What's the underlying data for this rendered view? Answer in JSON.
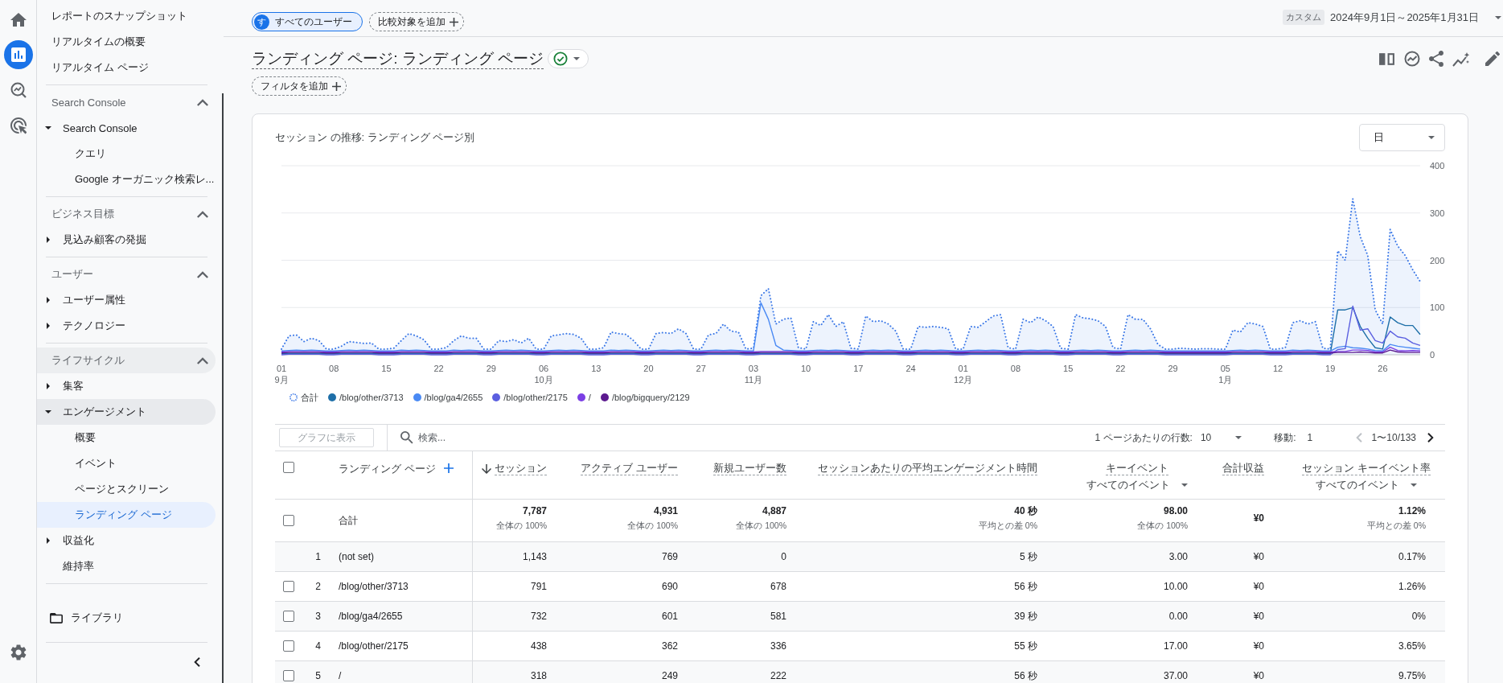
{
  "rail": [
    {
      "selected": false
    },
    {
      "selected": true
    },
    {
      "selected": false
    },
    {
      "selected": false
    }
  ],
  "nav": {
    "top_items": [
      {
        "label": "レポートのスナップショット",
        "selected": false
      },
      {
        "label": "リアルタイムの概要",
        "selected": false
      },
      {
        "label": "リアルタイム ページ",
        "selected": false
      }
    ],
    "sections": [
      {
        "title": "Search Console",
        "expanded": true,
        "highlighted": false,
        "items": [
          {
            "label": "Search Console",
            "expanded": true,
            "highlighted": false,
            "children": [
              {
                "label": "クエリ",
                "selected": false
              },
              {
                "label": "Google オーガニック検索レ...",
                "selected": false
              }
            ]
          }
        ]
      },
      {
        "title": "ビジネス目標",
        "expanded": true,
        "highlighted": false,
        "items": [
          {
            "label": "見込み顧客の発掘",
            "expanded": false,
            "highlighted": false
          }
        ]
      },
      {
        "title": "ユーザー",
        "expanded": true,
        "highlighted": false,
        "items": [
          {
            "label": "ユーザー属性",
            "expanded": false,
            "highlighted": false
          },
          {
            "label": "テクノロジー",
            "expanded": false,
            "highlighted": false
          }
        ]
      },
      {
        "title": "ライフサイクル",
        "expanded": true,
        "highlighted": true,
        "items": [
          {
            "label": "集客",
            "expanded": false,
            "highlighted": false
          },
          {
            "label": "エンゲージメント",
            "expanded": true,
            "highlighted": true,
            "children": [
              {
                "label": "概要",
                "selected": false
              },
              {
                "label": "イベント",
                "selected": false
              },
              {
                "label": "ページとスクリーン",
                "selected": false
              },
              {
                "label": "ランディング ページ",
                "selected": true
              }
            ]
          },
          {
            "label": "収益化",
            "expanded": false,
            "highlighted": false
          },
          {
            "label": "維持率",
            "highlighted": false
          }
        ]
      }
    ],
    "library": "ライブラリ"
  },
  "top_bar": {
    "segments": [
      {
        "avatar": "す",
        "label": "すべてのユーザー"
      }
    ],
    "add_comparison": "比較対象を追加",
    "date_badge": "カスタム",
    "date_range": "2024年9月1日～2025年1月31日"
  },
  "report": {
    "title": "ランディング ページ: ランディング ページ",
    "add_filter": "フィルタを追加"
  },
  "chart_card": {
    "granularity": "日",
    "chart_data": {
      "type": "line",
      "title": "セッション の推移: ランディング ページ別",
      "grid": true,
      "categories": [
        "01\n9月",
        null,
        null,
        null,
        null,
        null,
        null,
        "08",
        null,
        null,
        null,
        null,
        null,
        null,
        "15",
        null,
        null,
        null,
        null,
        null,
        null,
        "22",
        null,
        null,
        null,
        null,
        null,
        null,
        "29",
        null,
        null,
        null,
        null,
        null,
        null,
        "06\n10月",
        null,
        null,
        null,
        null,
        null,
        null,
        "13",
        null,
        null,
        null,
        null,
        null,
        null,
        "20",
        null,
        null,
        null,
        null,
        null,
        null,
        "27",
        null,
        null,
        null,
        null,
        null,
        null,
        "03\n11月",
        null,
        null,
        null,
        null,
        null,
        null,
        "10",
        null,
        null,
        null,
        null,
        null,
        null,
        "17",
        null,
        null,
        null,
        null,
        null,
        null,
        "24",
        null,
        null,
        null,
        null,
        null,
        null,
        "01\n12月",
        null,
        null,
        null,
        null,
        null,
        null,
        "08",
        null,
        null,
        null,
        null,
        null,
        null,
        "15",
        null,
        null,
        null,
        null,
        null,
        null,
        "22",
        null,
        null,
        null,
        null,
        null,
        null,
        "29",
        null,
        null,
        null,
        null,
        null,
        null,
        "05\n1月",
        null,
        null,
        null,
        null,
        null,
        null,
        "12",
        null,
        null,
        null,
        null,
        null,
        null,
        "19",
        null,
        null,
        null,
        null,
        null,
        null,
        "26",
        null,
        null,
        null,
        null,
        null
      ],
      "ylim": [
        0,
        400
      ],
      "yticks": [
        0,
        100,
        200,
        300,
        400
      ],
      "series": [
        {
          "name": "合計",
          "type": "area",
          "line_style": "dotted",
          "color": "#3b78e7",
          "values": [
            12,
            40,
            42,
            28,
            35,
            30,
            12,
            12,
            18,
            28,
            26,
            24,
            25,
            12,
            12,
            14,
            30,
            45,
            40,
            32,
            12,
            12,
            15,
            30,
            40,
            35,
            35,
            12,
            12,
            30,
            28,
            32,
            25,
            35,
            12,
            12,
            40,
            42,
            45,
            43,
            35,
            12,
            12,
            15,
            48,
            45,
            43,
            30,
            12,
            12,
            45,
            47,
            45,
            55,
            45,
            12,
            12,
            42,
            45,
            65,
            50,
            48,
            12,
            14,
            125,
            140,
            65,
            75,
            78,
            15,
            12,
            70,
            62,
            85,
            60,
            70,
            14,
            12,
            82,
            70,
            72,
            65,
            50,
            12,
            12,
            60,
            58,
            60,
            58,
            55,
            12,
            12,
            60,
            58,
            70,
            82,
            85,
            15,
            12,
            75,
            68,
            80,
            72,
            60,
            14,
            12,
            85,
            78,
            76,
            72,
            60,
            15,
            12,
            85,
            75,
            75,
            55,
            22,
            12,
            12,
            14,
            13,
            12,
            13,
            13,
            12,
            12,
            52,
            48,
            68,
            65,
            60,
            12,
            12,
            15,
            68,
            72,
            65,
            70,
            14,
            12,
            220,
            200,
            330,
            250,
            210,
            95,
            65,
            265,
            230,
            210,
            180,
            155
          ]
        },
        {
          "name": "/blog/other/3713",
          "line_style": "solid",
          "color": "#1e6fa8",
          "values": [
            2,
            3,
            3,
            3,
            3,
            3,
            2,
            2,
            3,
            3,
            3,
            3,
            3,
            2,
            2,
            2,
            3,
            3,
            3,
            3,
            2,
            2,
            2,
            3,
            3,
            3,
            3,
            2,
            2,
            3,
            3,
            3,
            3,
            3,
            2,
            2,
            3,
            3,
            3,
            3,
            3,
            2,
            2,
            2,
            3,
            3,
            3,
            3,
            2,
            2,
            3,
            3,
            3,
            3,
            3,
            2,
            2,
            3,
            3,
            3,
            3,
            3,
            2,
            2,
            3,
            3,
            3,
            3,
            3,
            2,
            2,
            3,
            3,
            3,
            3,
            3,
            2,
            2,
            3,
            3,
            3,
            3,
            3,
            2,
            2,
            3,
            3,
            3,
            3,
            3,
            2,
            2,
            3,
            3,
            3,
            3,
            3,
            2,
            2,
            3,
            3,
            3,
            3,
            3,
            2,
            2,
            3,
            3,
            3,
            3,
            3,
            2,
            2,
            3,
            3,
            3,
            3,
            3,
            2,
            2,
            2,
            2,
            2,
            2,
            2,
            2,
            2,
            3,
            3,
            3,
            3,
            3,
            2,
            2,
            2,
            3,
            3,
            3,
            3,
            2,
            2,
            95,
            95,
            100,
            60,
            35,
            15,
            12,
            80,
            68,
            62,
            62,
            43
          ]
        },
        {
          "name": "/blog/ga4/2655",
          "line_style": "solid",
          "color": "#4a8af4",
          "values": [
            8,
            9,
            10,
            9,
            10,
            9,
            8,
            8,
            9,
            10,
            9,
            10,
            9,
            8,
            8,
            8,
            10,
            9,
            10,
            9,
            8,
            8,
            8,
            10,
            9,
            10,
            9,
            8,
            8,
            9,
            10,
            9,
            10,
            9,
            8,
            8,
            9,
            10,
            9,
            10,
            9,
            8,
            8,
            8,
            10,
            9,
            10,
            9,
            8,
            8,
            9,
            10,
            9,
            10,
            9,
            8,
            8,
            9,
            10,
            9,
            10,
            9,
            8,
            8,
            110,
            75,
            20,
            10,
            9,
            8,
            8,
            9,
            10,
            9,
            10,
            9,
            8,
            8,
            9,
            10,
            9,
            10,
            9,
            8,
            8,
            9,
            10,
            9,
            10,
            9,
            8,
            8,
            9,
            10,
            9,
            10,
            9,
            8,
            8,
            9,
            10,
            9,
            10,
            9,
            8,
            8,
            9,
            10,
            9,
            10,
            9,
            8,
            8,
            9,
            10,
            9,
            10,
            9,
            8,
            8,
            8,
            8,
            8,
            8,
            8,
            8,
            8,
            9,
            10,
            9,
            10,
            9,
            8,
            8,
            8,
            10,
            9,
            10,
            9,
            8,
            8,
            16,
            18,
            15,
            14,
            12,
            9,
            8,
            22,
            18,
            16,
            14,
            12
          ]
        },
        {
          "name": "/blog/other/2175",
          "line_style": "solid",
          "color": "#5b5fe0",
          "values": [
            0,
            1,
            1,
            1,
            1,
            1,
            0,
            0,
            1,
            1,
            1,
            1,
            1,
            0,
            0,
            0,
            1,
            1,
            1,
            1,
            0,
            0,
            0,
            1,
            1,
            1,
            1,
            0,
            0,
            1,
            1,
            1,
            1,
            1,
            0,
            0,
            1,
            1,
            1,
            1,
            1,
            0,
            0,
            0,
            1,
            1,
            1,
            1,
            0,
            0,
            1,
            1,
            1,
            1,
            1,
            0,
            0,
            1,
            1,
            1,
            1,
            1,
            0,
            0,
            1,
            1,
            1,
            1,
            1,
            0,
            0,
            1,
            1,
            1,
            1,
            1,
            0,
            0,
            1,
            1,
            1,
            1,
            1,
            0,
            0,
            1,
            1,
            1,
            1,
            1,
            0,
            0,
            1,
            1,
            1,
            1,
            1,
            0,
            0,
            1,
            1,
            1,
            1,
            1,
            0,
            0,
            1,
            1,
            1,
            1,
            1,
            0,
            0,
            1,
            1,
            1,
            1,
            1,
            0,
            0,
            0,
            0,
            0,
            0,
            0,
            0,
            0,
            1,
            1,
            1,
            1,
            1,
            0,
            0,
            0,
            1,
            1,
            1,
            1,
            0,
            0,
            11,
            13,
            103,
            52,
            55,
            30,
            25,
            50,
            38,
            35,
            25,
            20
          ]
        },
        {
          "name": "/",
          "line_style": "solid",
          "color": "#7b3fe4",
          "values": [
            6,
            7,
            7,
            7,
            7,
            7,
            6,
            6,
            7,
            7,
            7,
            7,
            7,
            6,
            6,
            6,
            7,
            7,
            7,
            7,
            6,
            6,
            6,
            7,
            7,
            7,
            7,
            6,
            6,
            7,
            7,
            7,
            7,
            7,
            6,
            6,
            7,
            7,
            7,
            7,
            7,
            6,
            6,
            6,
            7,
            7,
            7,
            7,
            6,
            6,
            7,
            7,
            7,
            7,
            7,
            6,
            6,
            7,
            7,
            7,
            7,
            7,
            6,
            6,
            7,
            7,
            7,
            7,
            7,
            6,
            6,
            7,
            7,
            7,
            7,
            7,
            6,
            6,
            7,
            7,
            7,
            7,
            7,
            6,
            6,
            7,
            7,
            7,
            7,
            7,
            6,
            6,
            7,
            7,
            7,
            7,
            7,
            6,
            6,
            7,
            7,
            7,
            7,
            7,
            6,
            6,
            7,
            7,
            7,
            7,
            7,
            6,
            6,
            7,
            7,
            7,
            7,
            7,
            6,
            6,
            6,
            6,
            6,
            6,
            6,
            6,
            6,
            7,
            7,
            7,
            7,
            7,
            6,
            6,
            6,
            7,
            7,
            7,
            7,
            6,
            6,
            7,
            7,
            10,
            10,
            9,
            6,
            6,
            16,
            9,
            8,
            9,
            8
          ]
        },
        {
          "name": "/blog/bigquery/2129",
          "line_style": "solid",
          "color": "#5c1a8f",
          "values": [
            4,
            5,
            5,
            5,
            5,
            5,
            4,
            4,
            5,
            5,
            5,
            5,
            5,
            4,
            4,
            4,
            5,
            5,
            5,
            5,
            4,
            4,
            4,
            5,
            5,
            5,
            5,
            4,
            4,
            5,
            5,
            5,
            5,
            5,
            4,
            4,
            5,
            5,
            5,
            5,
            5,
            4,
            4,
            4,
            5,
            5,
            5,
            5,
            4,
            4,
            5,
            5,
            5,
            5,
            5,
            4,
            4,
            5,
            5,
            5,
            5,
            5,
            4,
            4,
            5,
            5,
            5,
            5,
            5,
            4,
            4,
            5,
            5,
            5,
            5,
            5,
            4,
            4,
            5,
            5,
            5,
            5,
            5,
            4,
            4,
            5,
            5,
            5,
            5,
            5,
            4,
            4,
            5,
            5,
            5,
            5,
            5,
            4,
            4,
            5,
            5,
            5,
            5,
            5,
            4,
            4,
            5,
            5,
            5,
            5,
            5,
            4,
            4,
            5,
            5,
            5,
            5,
            5,
            4,
            4,
            4,
            4,
            4,
            4,
            4,
            4,
            4,
            5,
            5,
            5,
            5,
            5,
            4,
            4,
            4,
            5,
            5,
            5,
            5,
            4,
            4,
            5,
            5,
            5,
            6,
            5,
            4,
            4,
            10,
            6,
            5,
            5,
            5
          ]
        }
      ]
    }
  },
  "table": {
    "chart_button": {
      "label": "グラフに表示",
      "disabled": true
    },
    "search_placeholder": "検索...",
    "rows_per_page_label": "1 ページあたりの行数:",
    "rows_per_page": "10",
    "go_to_label": "移動:",
    "go_to_value": "1",
    "page_range": "1〜10/133",
    "previous_disabled": true,
    "next_disabled": false,
    "select_all_checked": false,
    "dimension_header": "ランディング ページ",
    "columns": [
      {
        "label": "セッション",
        "sorted": true
      },
      {
        "label": "アクティブ ユーザー",
        "sorted": false
      },
      {
        "label": "新規ユーザー数",
        "sorted": false
      },
      {
        "label": "セッションあたりの平均エンゲージメント時間",
        "sorted": false
      },
      {
        "label": "キーイベント",
        "sorted": false,
        "filter": "すべてのイベント"
      },
      {
        "label": "合計収益",
        "sorted": false
      },
      {
        "label": "セッション キーイベント率",
        "sorted": false,
        "filter": "すべてのイベント"
      }
    ],
    "totals": {
      "label": "合計",
      "checked": false,
      "cells": [
        {
          "value": "7,787",
          "note": "全体の 100%"
        },
        {
          "value": "4,931",
          "note": "全体の 100%"
        },
        {
          "value": "4,887",
          "note": "全体の 100%"
        },
        {
          "value": "40 秒",
          "note": "平均との差 0%"
        },
        {
          "value": "98.00",
          "note": "全体の 100%"
        },
        {
          "value": "¥0"
        },
        {
          "value": "1.12%",
          "note": "平均との差 0%"
        }
      ]
    },
    "rows": [
      {
        "rank": "1",
        "name": "(not set)",
        "cells": [
          "1,143",
          "769",
          "0",
          "5 秒",
          "3.00",
          "¥0",
          "0.17%"
        ]
      },
      {
        "rank": "2",
        "name": "/blog/other/3713",
        "checked": false,
        "cells": [
          "791",
          "690",
          "678",
          "56 秒",
          "10.00",
          "¥0",
          "1.26%"
        ]
      },
      {
        "rank": "3",
        "name": "/blog/ga4/2655",
        "checked": false,
        "cells": [
          "732",
          "601",
          "581",
          "39 秒",
          "0.00",
          "¥0",
          "0%"
        ]
      },
      {
        "rank": "4",
        "name": "/blog/other/2175",
        "checked": false,
        "cells": [
          "438",
          "362",
          "336",
          "55 秒",
          "17.00",
          "¥0",
          "3.65%"
        ]
      },
      {
        "rank": "5",
        "name": "/",
        "checked": false,
        "cells": [
          "318",
          "249",
          "222",
          "56 秒",
          "37.00",
          "¥0",
          "9.75%"
        ]
      }
    ]
  }
}
